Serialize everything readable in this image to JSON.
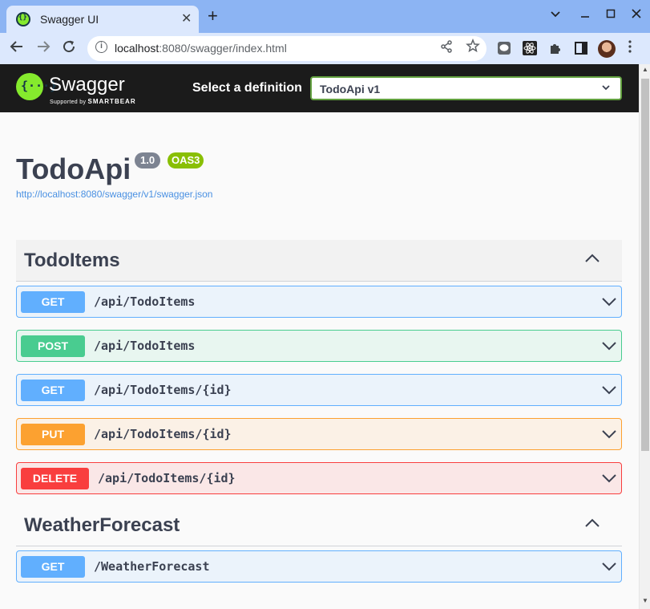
{
  "browser": {
    "tab_title": "Swagger UI",
    "tab_close": "✕",
    "new_tab": "+",
    "window_controls": [
      "⌄",
      "—",
      "☐",
      "✕"
    ],
    "url_host": "localhost",
    "url_rest": ":8080/swagger/index.html",
    "icons": [
      "back-icon",
      "forward-icon",
      "reload-icon",
      "info-icon",
      "share-icon",
      "star-icon",
      "line-extension-icon",
      "react-extension-icon",
      "puzzle-icon",
      "sidepanel-icon",
      "avatar",
      "menu-icon"
    ]
  },
  "swagger": {
    "brand": "Swagger",
    "supported_by": "Supported by",
    "smartbear": "SMARTBEAR",
    "definition_label": "Select a definition",
    "definition_value": "TodoApi v1"
  },
  "info": {
    "title": "TodoApi",
    "version": "1.0",
    "oas": "OAS3",
    "spec_url": "http://localhost:8080/swagger/v1/swagger.json"
  },
  "tags": [
    {
      "name": "TodoItems",
      "operations": [
        {
          "method": "GET",
          "path": "/api/TodoItems"
        },
        {
          "method": "POST",
          "path": "/api/TodoItems"
        },
        {
          "method": "GET",
          "path": "/api/TodoItems/{id}"
        },
        {
          "method": "PUT",
          "path": "/api/TodoItems/{id}"
        },
        {
          "method": "DELETE",
          "path": "/api/TodoItems/{id}"
        }
      ]
    },
    {
      "name": "WeatherForecast",
      "operations": [
        {
          "method": "GET",
          "path": "/WeatherForecast"
        }
      ]
    }
  ],
  "colors": {
    "get": "#61affe",
    "post": "#49cc90",
    "put": "#fca130",
    "delete": "#f93e3e",
    "swagger_green": "#85ea2d",
    "topbar": "#1b1b1b"
  }
}
